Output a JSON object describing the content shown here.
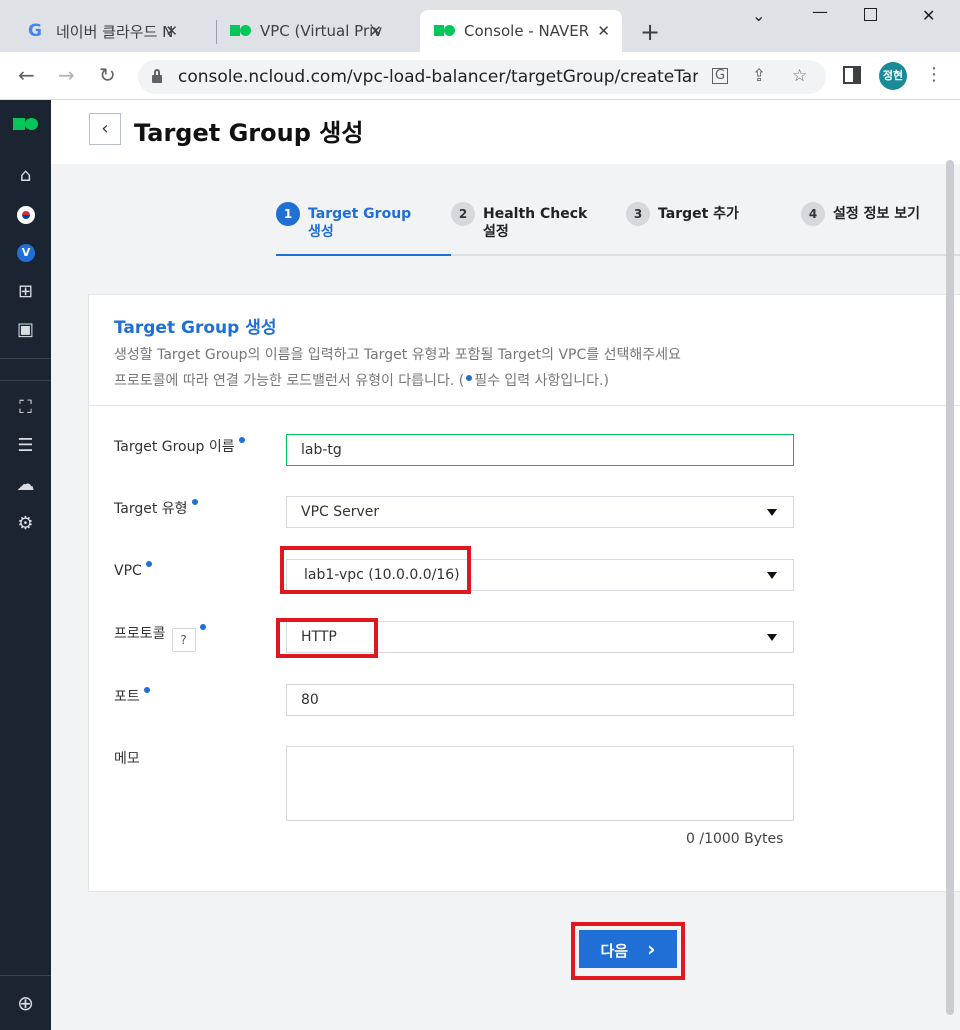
{
  "browser": {
    "tabs": [
      {
        "title": "네이버 클라우드 N",
        "favicon": "google-g"
      },
      {
        "title": "VPC (Virtual Privat",
        "favicon": "ncloud"
      },
      {
        "title": "Console - NAVER",
        "favicon": "ncloud",
        "active": true
      }
    ],
    "url": "console.ncloud.com/vpc-load-balancer/targetGroup/createTarge...",
    "profile_initials": "정현"
  },
  "sidebar": {
    "icons": [
      "home-icon",
      "korea-region-icon",
      "vpc-badge-icon",
      "grid-icon",
      "dashboard-icon",
      "network-icon",
      "server-icon",
      "cloud-icon",
      "settings-gear-icon",
      "globe-icon"
    ],
    "vpc_badge": "V"
  },
  "page": {
    "title": "Target Group 생성"
  },
  "steps": [
    {
      "num": "1",
      "label": "Target Group 생성",
      "active": true
    },
    {
      "num": "2",
      "label": "Health Check 설정"
    },
    {
      "num": "3",
      "label": "Target 추가"
    },
    {
      "num": "4",
      "label": "설정 정보 보기"
    }
  ],
  "form": {
    "title": "Target Group 생성",
    "desc_line1": "생성할 Target Group의 이름을 입력하고 Target 유형과 포함될 Target의 VPC를 선택해주세요",
    "desc_line2_pre": "프로토콜에 따라 연결 가능한 로드밸런서 유형이 다릅니다. (",
    "desc_line2_post": "필수 입력 사항입니다.)",
    "name_label": "Target Group 이름",
    "name_value": "lab-tg",
    "type_label": "Target 유형",
    "type_value": "VPC Server",
    "vpc_label": "VPC",
    "vpc_value": "lab1-vpc (10.0.0.0/16)",
    "protocol_label": "프로토콜",
    "protocol_help": "?",
    "protocol_value": "HTTP",
    "port_label": "포트",
    "port_value": "80",
    "memo_label": "메모",
    "memo_value": "",
    "memo_counter": "0 /1000 Bytes"
  },
  "actions": {
    "next_label": "다음",
    "next_arrow": "›"
  },
  "highlight_color": "#e0171f",
  "accent_color": "#1f6fd6"
}
